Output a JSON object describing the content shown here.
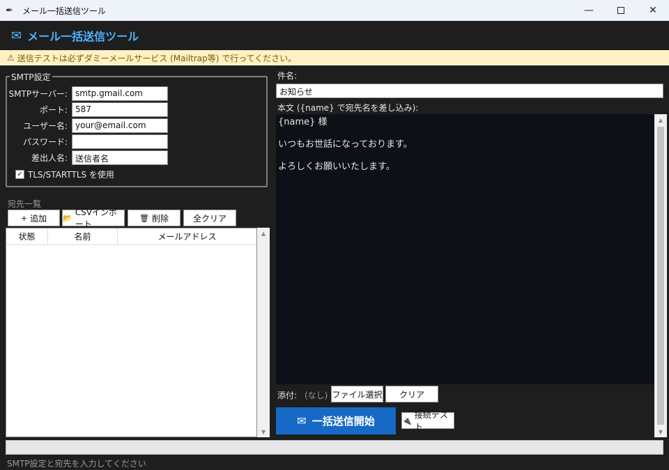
{
  "window": {
    "title": "メール一括送信ツール",
    "app_icon": "feather-icon",
    "minimize_glyph": "—",
    "close_glyph": "✕"
  },
  "header": {
    "icon_glyph": "✉",
    "title": "メール一括送信ツール"
  },
  "warning": {
    "icon_glyph": "⚠",
    "text": "送信テストは必ずダミーメールサービス (Mailtrap等) で行ってください。"
  },
  "smtp": {
    "legend": "SMTP設定",
    "fields": [
      {
        "label": "SMTPサーバー:",
        "value": "smtp.gmail.com"
      },
      {
        "label": "ポート:",
        "value": "587"
      },
      {
        "label": "ユーザー名:",
        "value": "your@email.com"
      },
      {
        "label": "パスワード:",
        "value": ""
      },
      {
        "label": "差出人名:",
        "value": "送信者名"
      }
    ],
    "tls_label": "TLS/STARTTLS を使用",
    "tls_checked": true,
    "check_glyph": "✓"
  },
  "recipients": {
    "label": "宛先一覧",
    "buttons": {
      "add": {
        "icon": "+",
        "label": "追加"
      },
      "import": {
        "icon": "📂",
        "label": "CSVインポート"
      },
      "delete": {
        "icon": "🗑",
        "label": "削除"
      },
      "clear_all": {
        "label": "全クリア"
      }
    },
    "columns": [
      "状態",
      "名前",
      "メールアドレス"
    ],
    "rows": []
  },
  "compose": {
    "subject_label": "件名:",
    "subject_value": "お知らせ",
    "body_label": "本文 ({name} で宛先名を差し込み):",
    "body_value": "{name} 様\n\nいつもお世話になっております。\n\nよろしくお願いいたします。",
    "attach_label": "添付:",
    "attach_value": "(なし)",
    "file_select_label": "ファイル選択",
    "attach_clear_label": "クリア",
    "send_icon": "✉",
    "send_label": "一括送信開始",
    "test_icon": "🔌",
    "test_label": "接続テスト"
  },
  "progress": {
    "value": 0
  },
  "status": {
    "text": "SMTP設定と宛先を入力してください"
  },
  "scroll_arrows": {
    "up": "▲",
    "down": "▼"
  }
}
